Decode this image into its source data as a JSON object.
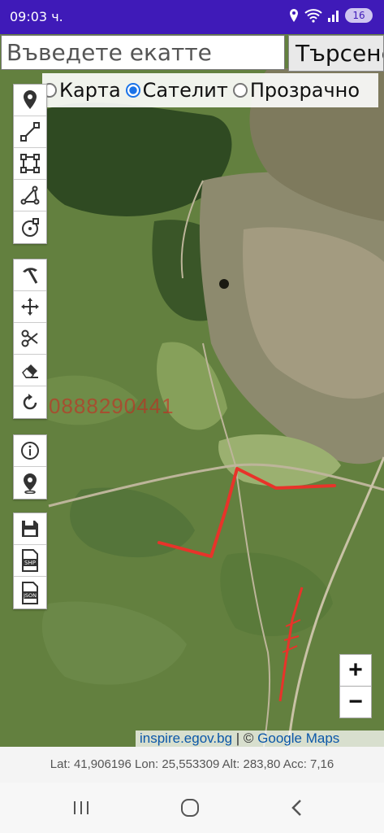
{
  "status_bar": {
    "time": "09:03 ч.",
    "battery": "16",
    "icons": [
      "location-icon",
      "wifi-icon",
      "signal-icon",
      "battery-icon"
    ]
  },
  "search": {
    "placeholder": "Въведете екатте",
    "button_label": "Търсене"
  },
  "layers": {
    "options": [
      "Карта",
      "Сателит",
      "Прозрачно"
    ],
    "selected": "Сателит"
  },
  "toolbar": {
    "groups": [
      [
        "marker-tool",
        "line-tool",
        "polygon-tool",
        "angle-measure-tool",
        "circle-tool"
      ],
      [
        "pickaxe-tool",
        "move-tool",
        "cut-tool",
        "eraser-tool",
        "undo-tool"
      ],
      [
        "info-tool",
        "location-pin-tool"
      ],
      [
        "save-tool",
        "export-shp-tool",
        "export-json-tool"
      ]
    ],
    "shp_label": "SHP",
    "json_label": "JSON"
  },
  "map": {
    "watermark": "0888290441",
    "zoom_in": "+",
    "zoom_out": "−",
    "attribution_link": "inspire.egov.bg",
    "attribution_sep": " | © ",
    "attribution_maps": "Google Maps",
    "track_color": "#e8332a"
  },
  "info": {
    "text": "Lat: 41,906196 Lon: 25,553309 Alt: 283,80 Acc: 7,16"
  },
  "colors": {
    "status_bar": "#3f1ab8",
    "radio_selected": "#1a73e8"
  }
}
